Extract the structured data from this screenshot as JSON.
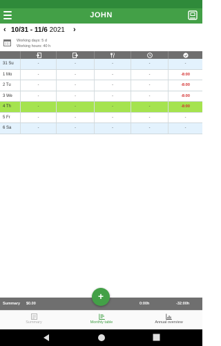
{
  "app": {
    "title": "JOHN"
  },
  "date_range": {
    "start": "10/31",
    "end": "11/6",
    "year": "2021"
  },
  "info": {
    "working_days": "Working days: 5 d",
    "working_hours": "Working hours: 40 h"
  },
  "columns": [
    "day",
    "clock-in",
    "clock-out",
    "break",
    "duration",
    "balance"
  ],
  "rows": [
    {
      "day": "31 Su",
      "cells": [
        "-",
        "-",
        "-",
        "-",
        "-"
      ],
      "type": "weekend"
    },
    {
      "day": "1 Mo",
      "cells": [
        "-",
        "-",
        "-",
        "-",
        "-8:00"
      ],
      "type": "normal"
    },
    {
      "day": "2 Tu",
      "cells": [
        "-",
        "-",
        "-",
        "-",
        "-8:00"
      ],
      "type": "normal"
    },
    {
      "day": "3 We",
      "cells": [
        "-",
        "-",
        "-",
        "-",
        "-8:00"
      ],
      "type": "normal"
    },
    {
      "day": "4 Th",
      "cells": [
        "-",
        "-",
        "-",
        "-",
        "-8:00"
      ],
      "type": "today"
    },
    {
      "day": "5 Fr",
      "cells": [
        "-",
        "-",
        "-",
        "-",
        "-"
      ],
      "type": "normal"
    },
    {
      "day": "6 Sa",
      "cells": [
        "-",
        "-",
        "-",
        "-",
        "-"
      ],
      "type": "weekend"
    }
  ],
  "summary": {
    "label": "Summary",
    "amount": "$0.00",
    "hours": "0:00h",
    "balance": "-32:00h"
  },
  "fab": {
    "label": "+"
  },
  "bottom_nav": [
    {
      "label": "Summary",
      "icon": "summary-icon",
      "state": "disabled"
    },
    {
      "label": "Monthly table",
      "icon": "monthly-table-icon",
      "state": "active"
    },
    {
      "label": "Annual overview",
      "icon": "annual-overview-icon",
      "state": "normal"
    }
  ],
  "colors": {
    "primary": "#43a047",
    "today_row": "#a5e34f",
    "weekend_row": "#e3f2fd",
    "negative": "#d32f2f",
    "header": "#6f6f6f"
  }
}
